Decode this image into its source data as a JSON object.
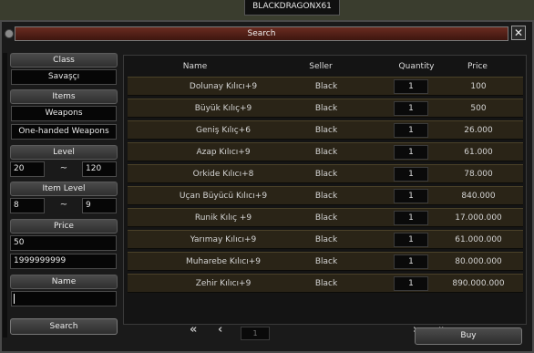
{
  "header": {
    "character_name": "BLACKDRAGONX61"
  },
  "window": {
    "title": "Search",
    "close_symbol": "✕"
  },
  "filters": {
    "class_label": "Class",
    "class_value": "Savaşçı",
    "items_label": "Items",
    "items_value": "Weapons",
    "subtype_value": "One-handed Weapons",
    "level_label": "Level",
    "level_min": "20",
    "level_max": "120",
    "item_level_label": "Item Level",
    "item_level_min": "8",
    "item_level_max": "9",
    "range_separator": "~",
    "price_label": "Price",
    "price_min": "50",
    "price_max": "1999999999",
    "name_label": "Name",
    "name_value": "",
    "search_button": "Search"
  },
  "table": {
    "columns": [
      "Name",
      "Seller",
      "Quantity",
      "Price"
    ],
    "rows": [
      {
        "name": "Dolunay Kılıcı+9",
        "seller": "Black",
        "quantity": "1",
        "price": "100"
      },
      {
        "name": "Büyük Kılıç+9",
        "seller": "Black",
        "quantity": "1",
        "price": "500"
      },
      {
        "name": "Geniş Kılıç+6",
        "seller": "Black",
        "quantity": "1",
        "price": "26.000"
      },
      {
        "name": "Azap Kılıcı+9",
        "seller": "Black",
        "quantity": "1",
        "price": "61.000"
      },
      {
        "name": "Orkide Kılıcı+8",
        "seller": "Black",
        "quantity": "1",
        "price": "78.000"
      },
      {
        "name": "Uçan Büyücü Kılıcı+9",
        "seller": "Black",
        "quantity": "1",
        "price": "840.000"
      },
      {
        "name": "Runik Kılıç +9",
        "seller": "Black",
        "quantity": "1",
        "price": "17.000.000"
      },
      {
        "name": "Yarımay Kılıcı+9",
        "seller": "Black",
        "quantity": "1",
        "price": "61.000.000"
      },
      {
        "name": "Muharebe Kılıcı+9",
        "seller": "Black",
        "quantity": "1",
        "price": "80.000.000"
      },
      {
        "name": "Zehir Kılıcı+9",
        "seller": "Black",
        "quantity": "1",
        "price": "890.000.000"
      }
    ]
  },
  "pagination": {
    "first": "«",
    "prev": "‹",
    "page": "1",
    "next": "›",
    "last": "»"
  },
  "actions": {
    "buy_button": "Buy"
  }
}
